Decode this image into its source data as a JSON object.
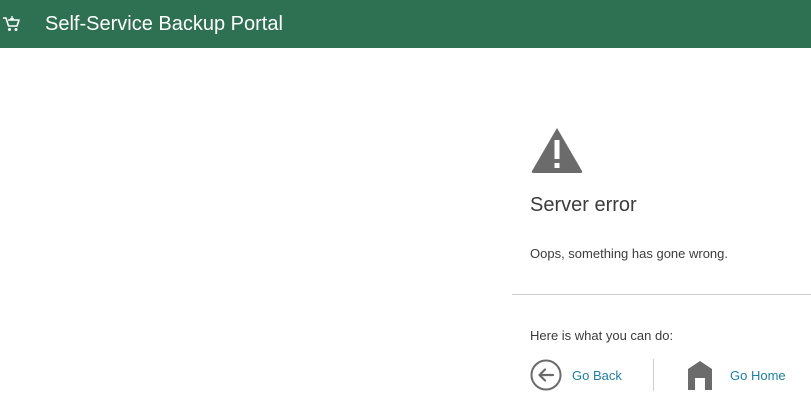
{
  "header": {
    "title": "Self-Service Backup Portal",
    "cart_icon": "cart-icon",
    "background_color": "#2e7052"
  },
  "error": {
    "icon": "warning-icon",
    "title": "Server error",
    "message": "Oops, something has gone wrong."
  },
  "actions": {
    "hint": "Here is what you can do:",
    "back": {
      "label": "Go Back",
      "icon": "arrow-left-circle-icon"
    },
    "home": {
      "label": "Go Home",
      "icon": "home-icon"
    },
    "link_color": "#1f7fa6"
  }
}
